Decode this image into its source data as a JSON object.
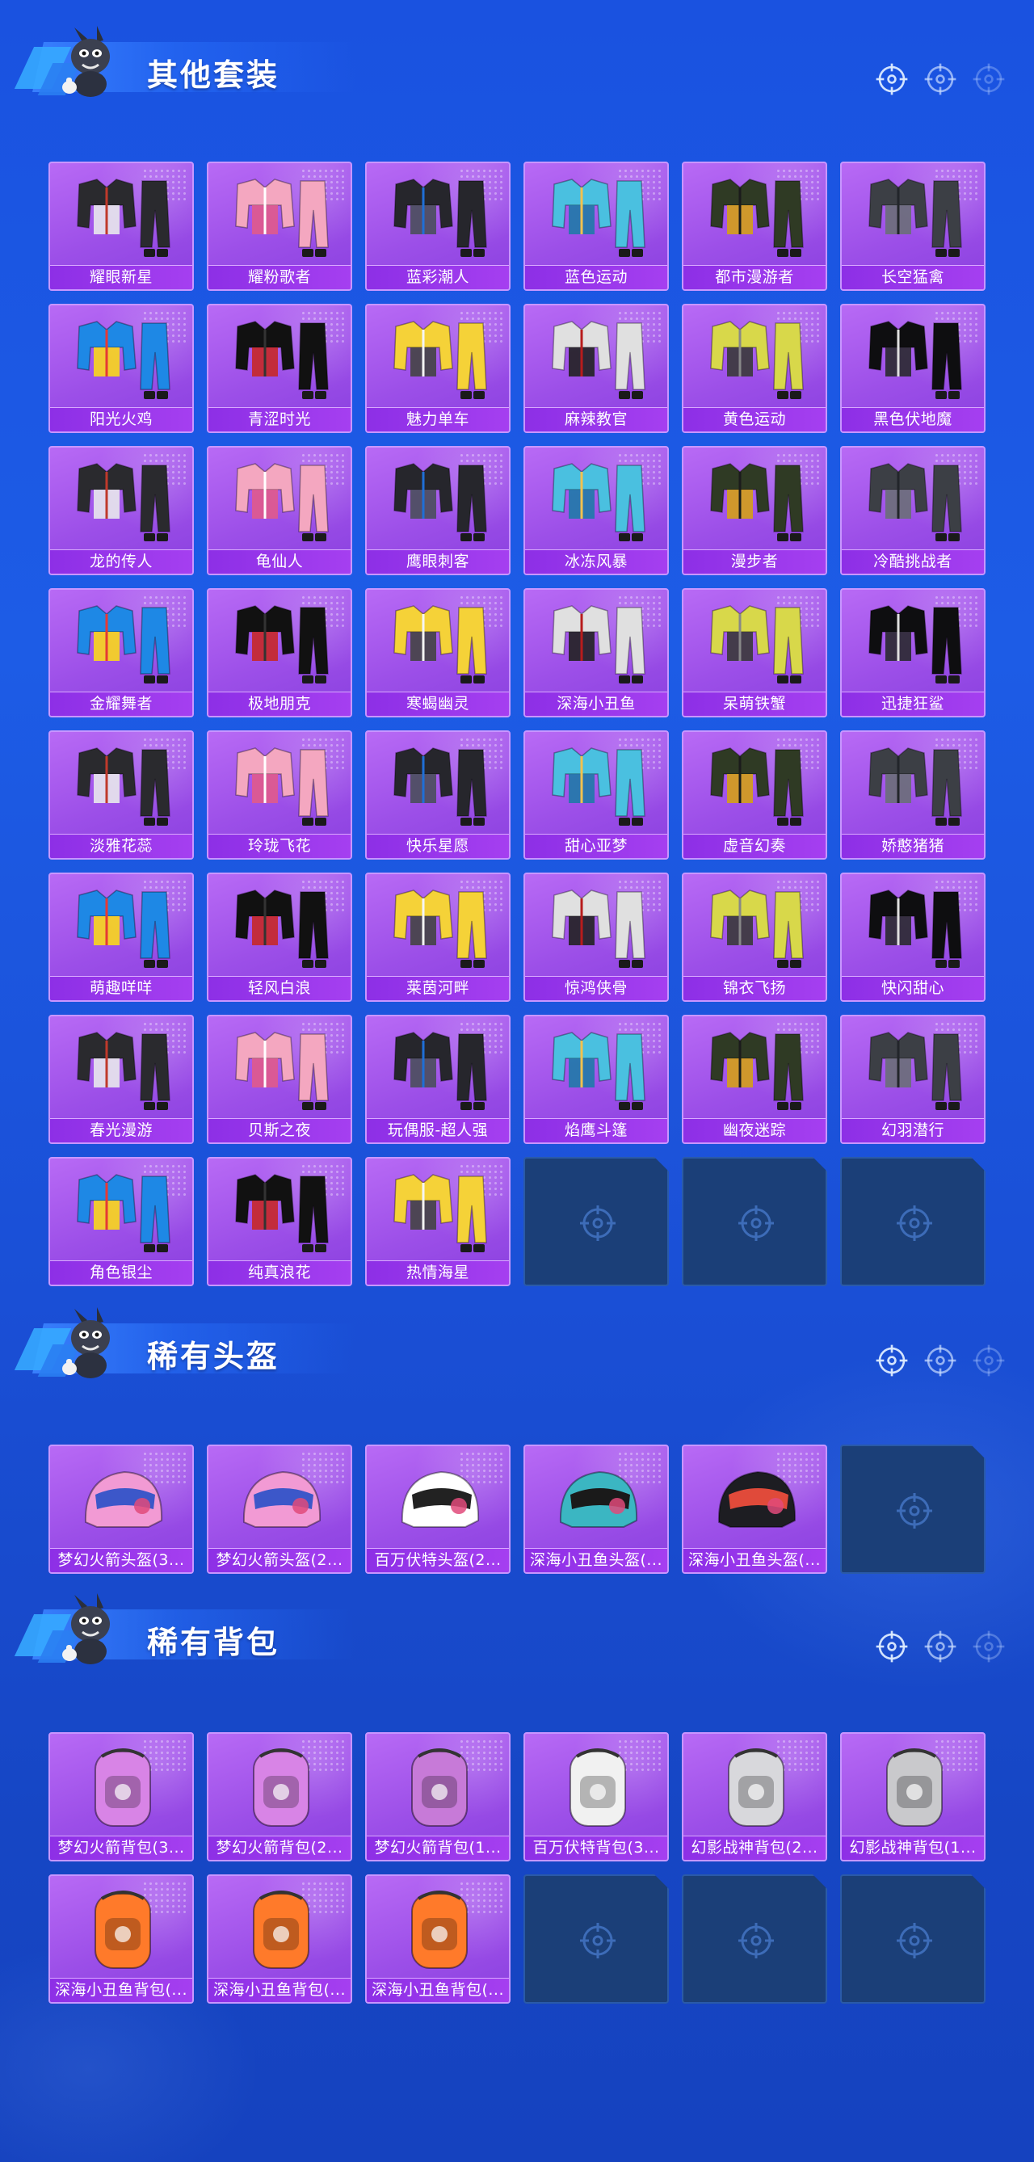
{
  "sections": [
    {
      "title": "其他套装",
      "items": [
        "耀眼新星",
        "耀粉歌者",
        "蓝彩潮人",
        "蓝色运动",
        "都市漫游者",
        "长空猛禽",
        "阳光火鸡",
        "青涩时光",
        "魅力单车",
        "麻辣教官",
        "黄色运动",
        "黑色伏地魔",
        "龙的传人",
        "龟仙人",
        "鹰眼刺客",
        "冰冻风暴",
        "漫步者",
        "冷酷挑战者",
        "金耀舞者",
        "极地朋克",
        "寒蝎幽灵",
        "深海小丑鱼",
        "呆萌铁蟹",
        "迅捷狂鲨",
        "淡雅花蕊",
        "玲珑飞花",
        "快乐星愿",
        "甜心亚梦",
        "虚音幻奏",
        "娇憨猪猪",
        "萌趣咩咩",
        "轻风白浪",
        "莱茵河畔",
        "惊鸿侠骨",
        "锦衣飞扬",
        "快闪甜心",
        "春光漫游",
        "贝斯之夜",
        "玩偶服-超人强",
        "焰鹰斗篷",
        "幽夜迷踪",
        "幻羽潜行",
        "角色银尘",
        "纯真浪花",
        "热情海星"
      ],
      "empty_slots": 3
    },
    {
      "title": "稀有头盔",
      "items": [
        "梦幻火箭头盔(3...",
        "梦幻火箭头盔(2...",
        "百万伏特头盔(2...",
        "深海小丑鱼头盔(...",
        "深海小丑鱼头盔(..."
      ],
      "empty_slots": 1
    },
    {
      "title": "稀有背包",
      "items": [
        "梦幻火箭背包(3...",
        "梦幻火箭背包(2...",
        "梦幻火箭背包(1...",
        "百万伏特背包(3...",
        "幻影战神背包(2...",
        "幻影战神背包(1...",
        "深海小丑鱼背包(...",
        "深海小丑鱼背包(...",
        "深海小丑鱼背包(..."
      ],
      "empty_slots": 3
    }
  ],
  "icons": {
    "header_mascot": "mascot-icon",
    "header_decor": "crosshair-icon",
    "empty_slot": "crosshair-icon"
  },
  "colors": {
    "background": "#1a52e0",
    "card_purple": "#9c4fe8",
    "label_purple": "#8d2fe6",
    "empty_slot": "#1b3f78"
  }
}
